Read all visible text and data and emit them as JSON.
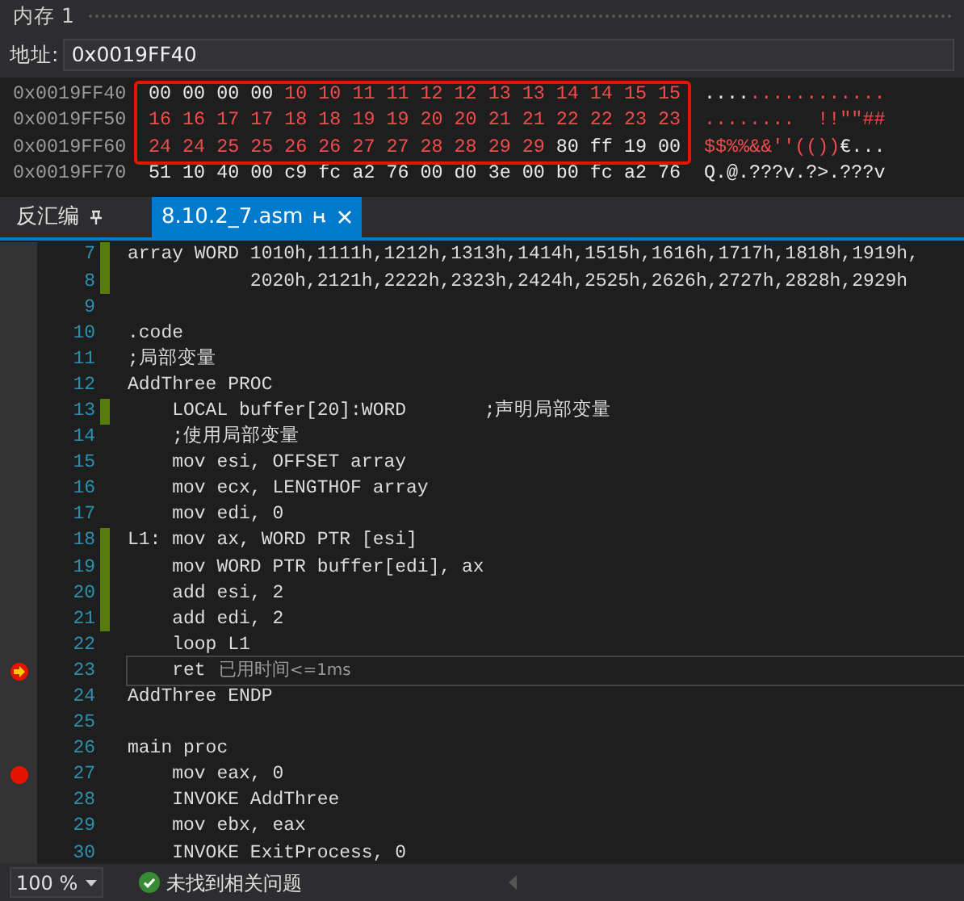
{
  "memory_window": {
    "title": "内存 1",
    "address_label": "地址:",
    "address_value": "0x0019FF40",
    "rows": [
      {
        "address": "0x0019FF40",
        "bytes": [
          {
            "text": "00",
            "changed": false
          },
          {
            "text": "00",
            "changed": false
          },
          {
            "text": "00",
            "changed": false
          },
          {
            "text": "00",
            "changed": false
          },
          {
            "text": "10",
            "changed": true
          },
          {
            "text": "10",
            "changed": true
          },
          {
            "text": "11",
            "changed": true
          },
          {
            "text": "11",
            "changed": true
          },
          {
            "text": "12",
            "changed": true
          },
          {
            "text": "12",
            "changed": true
          },
          {
            "text": "13",
            "changed": true
          },
          {
            "text": "13",
            "changed": true
          },
          {
            "text": "14",
            "changed": true
          },
          {
            "text": "14",
            "changed": true
          },
          {
            "text": "15",
            "changed": true
          },
          {
            "text": "15",
            "changed": true
          }
        ],
        "ascii": [
          {
            "text": "....",
            "changed": false
          },
          {
            "text": "............",
            "changed": true
          }
        ]
      },
      {
        "address": "0x0019FF50",
        "bytes": [
          {
            "text": "16",
            "changed": true
          },
          {
            "text": "16",
            "changed": true
          },
          {
            "text": "17",
            "changed": true
          },
          {
            "text": "17",
            "changed": true
          },
          {
            "text": "18",
            "changed": true
          },
          {
            "text": "18",
            "changed": true
          },
          {
            "text": "19",
            "changed": true
          },
          {
            "text": "19",
            "changed": true
          },
          {
            "text": "20",
            "changed": true
          },
          {
            "text": "20",
            "changed": true
          },
          {
            "text": "21",
            "changed": true
          },
          {
            "text": "21",
            "changed": true
          },
          {
            "text": "22",
            "changed": true
          },
          {
            "text": "22",
            "changed": true
          },
          {
            "text": "23",
            "changed": true
          },
          {
            "text": "23",
            "changed": true
          }
        ],
        "ascii": [
          {
            "text": "........  !!\"\"##",
            "changed": true
          }
        ]
      },
      {
        "address": "0x0019FF60",
        "bytes": [
          {
            "text": "24",
            "changed": true
          },
          {
            "text": "24",
            "changed": true
          },
          {
            "text": "25",
            "changed": true
          },
          {
            "text": "25",
            "changed": true
          },
          {
            "text": "26",
            "changed": true
          },
          {
            "text": "26",
            "changed": true
          },
          {
            "text": "27",
            "changed": true
          },
          {
            "text": "27",
            "changed": true
          },
          {
            "text": "28",
            "changed": true
          },
          {
            "text": "28",
            "changed": true
          },
          {
            "text": "29",
            "changed": true
          },
          {
            "text": "29",
            "changed": true
          },
          {
            "text": "80",
            "changed": false
          },
          {
            "text": "ff",
            "changed": false
          },
          {
            "text": "19",
            "changed": false
          },
          {
            "text": "00",
            "changed": false
          }
        ],
        "ascii": [
          {
            "text": "$$%%&&''(())",
            "changed": true
          },
          {
            "text": "€...",
            "changed": false
          }
        ]
      },
      {
        "address": "0x0019FF70",
        "bytes": [
          {
            "text": "51",
            "changed": false
          },
          {
            "text": "10",
            "changed": false
          },
          {
            "text": "40",
            "changed": false
          },
          {
            "text": "00",
            "changed": false
          },
          {
            "text": "c9",
            "changed": false
          },
          {
            "text": "fc",
            "changed": false
          },
          {
            "text": "a2",
            "changed": false
          },
          {
            "text": "76",
            "changed": false
          },
          {
            "text": "00",
            "changed": false
          },
          {
            "text": "d0",
            "changed": false
          },
          {
            "text": "3e",
            "changed": false
          },
          {
            "text": "00",
            "changed": false
          },
          {
            "text": "b0",
            "changed": false
          },
          {
            "text": "fc",
            "changed": false
          },
          {
            "text": "a2",
            "changed": false
          },
          {
            "text": "76",
            "changed": false
          }
        ],
        "ascii": [
          {
            "text": "Q.@.???v.?>.???v",
            "changed": false
          }
        ]
      }
    ]
  },
  "tabs": [
    {
      "label": "反汇编",
      "selected": false,
      "closable": false
    },
    {
      "label": "8.10.2_7.asm",
      "selected": true,
      "closable": true
    }
  ],
  "editor": {
    "lines": [
      {
        "number": "7",
        "text": "array WORD 1010h,1111h,1212h,1313h,1414h,1515h,1616h,1717h,1818h,1919h,",
        "changed": true,
        "breakpoint": false,
        "current": false
      },
      {
        "number": "8",
        "text": "           2020h,2121h,2222h,2323h,2424h,2525h,2626h,2727h,2828h,2929h",
        "changed": true,
        "breakpoint": false,
        "current": false
      },
      {
        "number": "9",
        "changed": false,
        "breakpoint": false,
        "current": false
      },
      {
        "number": "10",
        "text": ".code",
        "changed": false,
        "breakpoint": false,
        "current": false
      },
      {
        "number": "11",
        "text": ";局部变量",
        "changed": false,
        "breakpoint": false,
        "current": false
      },
      {
        "number": "12",
        "text": "AddThree PROC",
        "changed": false,
        "breakpoint": false,
        "current": false
      },
      {
        "number": "13",
        "text": "    LOCAL buffer[20]:WORD       ;声明局部变量",
        "changed": true,
        "breakpoint": false,
        "current": false
      },
      {
        "number": "14",
        "text": "    ;使用局部变量",
        "changed": false,
        "breakpoint": false,
        "current": false
      },
      {
        "number": "15",
        "text": "    mov esi, OFFSET array",
        "changed": false,
        "breakpoint": false,
        "current": false
      },
      {
        "number": "16",
        "text": "    mov ecx, LENGTHOF array",
        "changed": false,
        "breakpoint": false,
        "current": false
      },
      {
        "number": "17",
        "text": "    mov edi, 0",
        "changed": false,
        "breakpoint": false,
        "current": false
      },
      {
        "number": "18",
        "text": "L1: mov ax, WORD PTR [esi]",
        "changed": true,
        "breakpoint": false,
        "current": false
      },
      {
        "number": "19",
        "text": "    mov WORD PTR buffer[edi], ax",
        "changed": true,
        "breakpoint": false,
        "current": false
      },
      {
        "number": "20",
        "text": "    add esi, 2",
        "changed": true,
        "breakpoint": false,
        "current": false
      },
      {
        "number": "21",
        "text": "    add edi, 2",
        "changed": true,
        "breakpoint": false,
        "current": false
      },
      {
        "number": "22",
        "text": "    loop L1",
        "changed": false,
        "breakpoint": false,
        "current": false
      },
      {
        "number": "23",
        "text": "    ret",
        "changed": false,
        "breakpoint": true,
        "current": true,
        "hint_label": "已用时间",
        "hint_value": "<=1ms"
      },
      {
        "number": "24",
        "text": "AddThree ENDP",
        "changed": false,
        "breakpoint": false,
        "current": false
      },
      {
        "number": "25",
        "changed": false,
        "breakpoint": false,
        "current": false
      },
      {
        "number": "26",
        "text": "main proc",
        "changed": false,
        "breakpoint": false,
        "current": false
      },
      {
        "number": "27",
        "text": "    mov eax, 0",
        "changed": false,
        "breakpoint": true,
        "current": false
      },
      {
        "number": "28",
        "text": "    INVOKE AddThree",
        "changed": false,
        "breakpoint": false,
        "current": false
      },
      {
        "number": "29",
        "text": "    mov ebx, eax",
        "changed": false,
        "breakpoint": false,
        "current": false
      },
      {
        "number": "30",
        "text": "    INVOKE ExitProcess, 0",
        "changed": false,
        "breakpoint": false,
        "current": false
      }
    ]
  },
  "status_bar": {
    "zoom": "100 %",
    "issues": "未找到相关问题"
  }
}
